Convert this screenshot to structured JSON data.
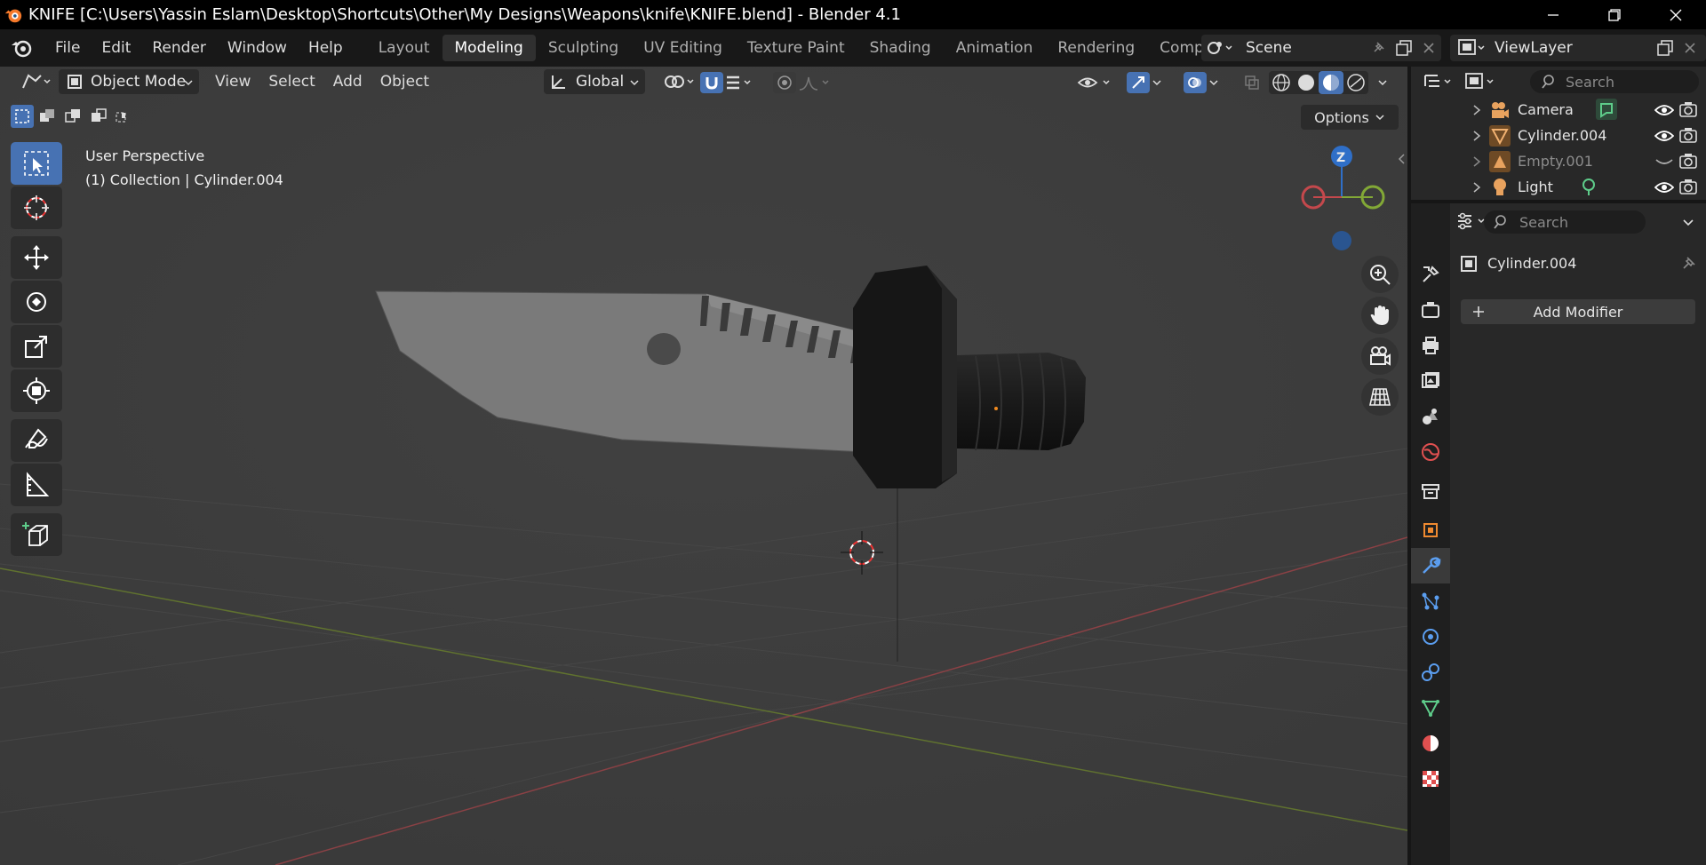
{
  "window": {
    "title": "KNIFE [C:\\Users\\Yassin Eslam\\Desktop\\Shortcuts\\Other\\My Designs\\Weapons\\knife\\KNIFE.blend] - Blender 4.1"
  },
  "menu": {
    "items": [
      "File",
      "Edit",
      "Render",
      "Window",
      "Help"
    ]
  },
  "workspaces": {
    "tabs": [
      "Layout",
      "Modeling",
      "Sculpting",
      "UV Editing",
      "Texture Paint",
      "Shading",
      "Animation",
      "Rendering",
      "Compositing"
    ],
    "active": "Modeling"
  },
  "scene": {
    "name": "Scene"
  },
  "view_layer": {
    "name": "ViewLayer"
  },
  "viewport": {
    "mode": "Object Mode",
    "menus": [
      "View",
      "Select",
      "Add",
      "Object"
    ],
    "orientation": "Global",
    "options_label": "Options",
    "perspective": "User Perspective",
    "context": "(1) Collection | Cylinder.004",
    "axis_z": "Z"
  },
  "outliner": {
    "search_placeholder": "Search",
    "rows": [
      {
        "name": "Camera",
        "icon": "camera-icon",
        "color": "#e8a25e",
        "extra_icon": "camera-data-icon",
        "extra_color": "#5ecc8a",
        "visible": true
      },
      {
        "name": "Cylinder.004",
        "icon": "mesh-icon",
        "color": "#e8a25e",
        "visible": true
      },
      {
        "name": "Empty.001",
        "icon": "empty-icon",
        "color": "#e8a25e",
        "visible": false
      },
      {
        "name": "Light",
        "icon": "light-icon",
        "color": "#e8a25e",
        "extra_icon": "light-data-icon",
        "extra_color": "#5ecc8a",
        "visible": true
      }
    ]
  },
  "properties": {
    "search_placeholder": "Search",
    "object_name": "Cylinder.004",
    "add_modifier_label": "Add Modifier",
    "tabs": [
      "tool",
      "render",
      "output",
      "view-layer",
      "scene",
      "world",
      "collection",
      "object",
      "modifiers",
      "particles",
      "physics",
      "constraints",
      "data",
      "material",
      "texture"
    ],
    "active_tab": "modifiers"
  },
  "colors": {
    "accent": "#4772b3",
    "viewport_bg": "#3d3d3d",
    "axis_x": "#c4484c",
    "axis_y": "#82a836",
    "axis_z": "#2f6fc8"
  }
}
